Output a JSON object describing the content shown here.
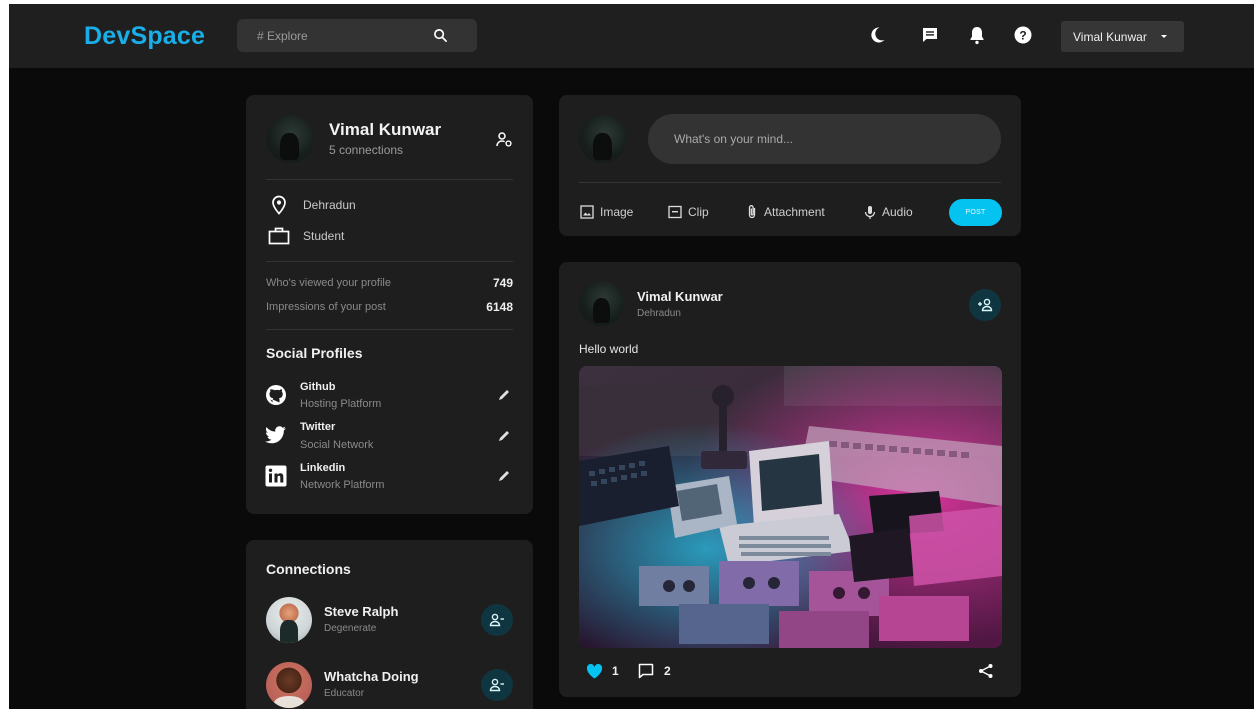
{
  "navbar": {
    "logo": "DevSpace",
    "search_placeholder": "# Explore",
    "icons": [
      "moon-icon",
      "chat-icon",
      "bell-icon",
      "help-icon"
    ],
    "user_name": "Vimal Kunwar"
  },
  "colors": {
    "accent": "#19aee8",
    "post_button": "#05c3f0",
    "card_bg": "#1e1e1e",
    "page_bg": "#0a0a0a",
    "like": "#05c3f0"
  },
  "profile": {
    "name": "Vimal Kunwar",
    "connections": "5 connections",
    "location": "Dehradun",
    "occupation": "Student",
    "stats": [
      {
        "label": "Who's viewed your profile",
        "value": "749"
      },
      {
        "label": "Impressions of your post",
        "value": "6148"
      }
    ],
    "social_title": "Social Profiles",
    "socials": [
      {
        "name": "Github",
        "desc": "Hosting Platform",
        "icon": "github-icon"
      },
      {
        "name": "Twitter",
        "desc": "Social Network",
        "icon": "twitter-icon"
      },
      {
        "name": "Linkedin",
        "desc": "Network Platform",
        "icon": "linkedin-icon"
      }
    ]
  },
  "connections": {
    "title": "Connections",
    "items": [
      {
        "name": "Steve Ralph",
        "role": "Degenerate"
      },
      {
        "name": "Whatcha Doing",
        "role": "Educator"
      }
    ]
  },
  "composer": {
    "placeholder": "What's on your mind...",
    "actions": [
      "Image",
      "Clip",
      "Attachment",
      "Audio"
    ],
    "post_label": "POST"
  },
  "post": {
    "author": "Vimal Kunwar",
    "location": "Dehradun",
    "text": "Hello world",
    "likes": "1",
    "comments": "2",
    "liked": true
  }
}
